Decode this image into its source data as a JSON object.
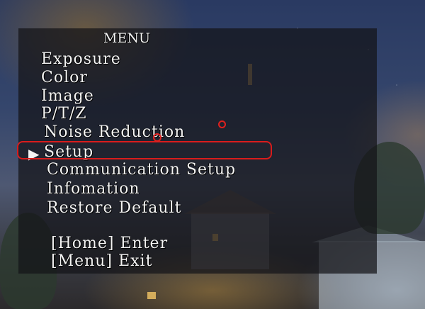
{
  "osd_menu": {
    "title": "MENU",
    "pointer_glyph": "▶",
    "items": [
      {
        "label": "Exposure"
      },
      {
        "label": "Color"
      },
      {
        "label": "Image"
      },
      {
        "label": "P/T/Z"
      },
      {
        "label": "Noise Reduction"
      },
      {
        "label": "Setup",
        "selected": true
      },
      {
        "label": "Communication Setup"
      },
      {
        "label": "Infomation"
      },
      {
        "label": "Restore Default"
      }
    ],
    "hints": [
      {
        "key": "[Home]",
        "action": "Enter"
      },
      {
        "key": "[Menu]",
        "action": "Exit"
      }
    ]
  },
  "colors": {
    "osd_text": "#f4f4f4",
    "highlight": "#d91c1c",
    "panel": "#141418"
  }
}
